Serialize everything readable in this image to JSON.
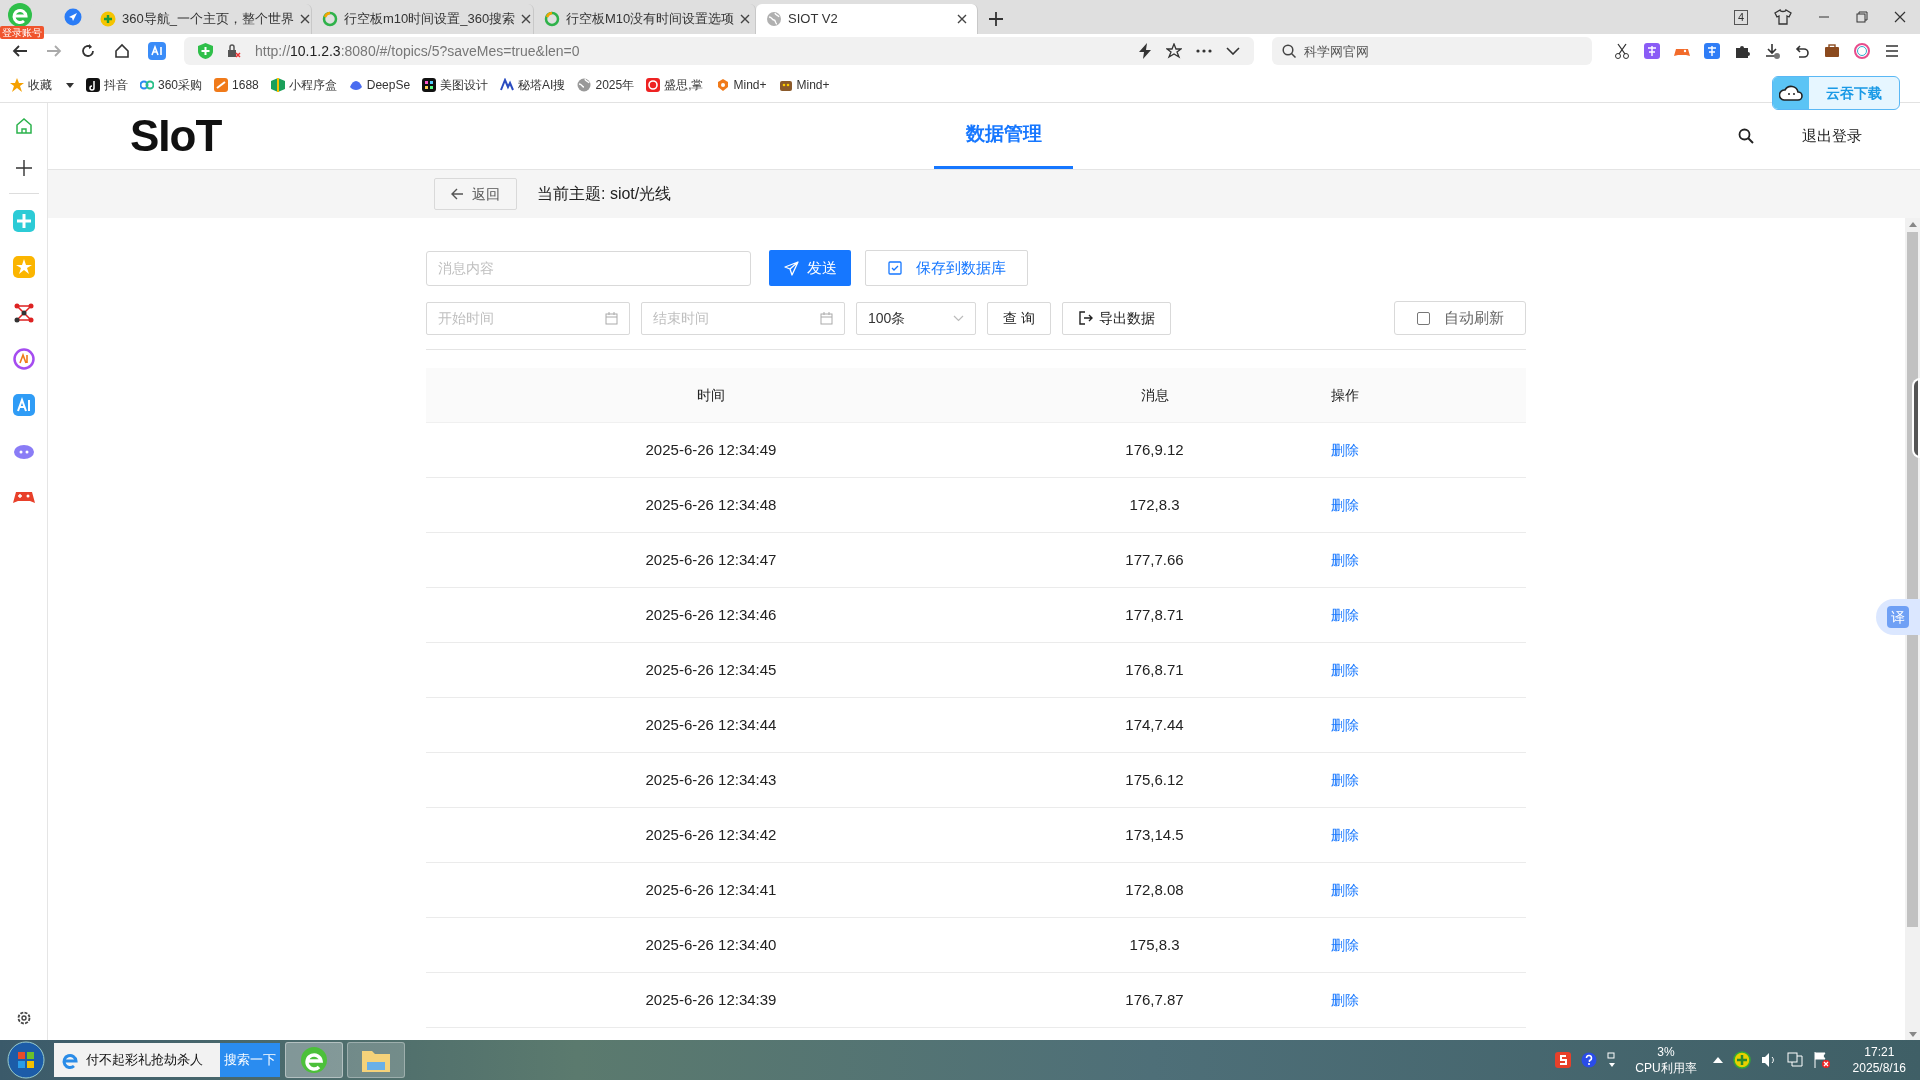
{
  "browser": {
    "login_badge": "登录账号",
    "tabs": [
      {
        "title": "360导航_一个主页，整个世界",
        "selected": false
      },
      {
        "title": "行空板m10时间设置_360搜索",
        "selected": false
      },
      {
        "title": "行空板M10没有时间设置选项",
        "selected": false
      },
      {
        "title": "SIOT V2",
        "selected": true
      }
    ],
    "tab_count": "4",
    "address_host": "10.1.2.3",
    "address_prefix": "http://",
    "address_rest": ":8080/#/topics/5?saveMes=true&len=0",
    "search_placeholder": "科学网官网",
    "bookmarks": [
      "收藏",
      "抖音",
      "360采购",
      "1688",
      "小程序盒",
      "DeepSe",
      "美图设计",
      "秘塔AI搜",
      "2025年",
      "盛思,掌",
      "Mind+",
      "Mind+"
    ],
    "download_button": "云吞下载"
  },
  "app": {
    "logo": "SIoT",
    "nav": [
      {
        "label": "数据管理",
        "selected": true
      }
    ],
    "logout": "退出登录",
    "back": "返回",
    "topic": "当前主题: siot/光线",
    "message_placeholder": "消息内容",
    "send": "发送",
    "save": "保存到数据库",
    "start_placeholder": "开始时间",
    "end_placeholder": "结束时间",
    "limit": "100条",
    "query": "查 询",
    "export": "导出数据",
    "auto_refresh": {
      "label": "自动刷新",
      "checked": false
    },
    "columns": [
      "时间",
      "消息",
      "操作"
    ],
    "rows": [
      {
        "time": "2025-6-26 12:34:49",
        "message": "176,9.12",
        "action": "删除"
      },
      {
        "time": "2025-6-26 12:34:48",
        "message": "172,8.3",
        "action": "删除"
      },
      {
        "time": "2025-6-26 12:34:47",
        "message": "177,7.66",
        "action": "删除"
      },
      {
        "time": "2025-6-26 12:34:46",
        "message": "177,8.71",
        "action": "删除"
      },
      {
        "time": "2025-6-26 12:34:45",
        "message": "176,8.71",
        "action": "删除"
      },
      {
        "time": "2025-6-26 12:34:44",
        "message": "174,7.44",
        "action": "删除"
      },
      {
        "time": "2025-6-26 12:34:43",
        "message": "175,6.12",
        "action": "删除"
      },
      {
        "time": "2025-6-26 12:34:42",
        "message": "173,14.5",
        "action": "删除"
      },
      {
        "time": "2025-6-26 12:34:41",
        "message": "172,8.08",
        "action": "删除"
      },
      {
        "time": "2025-6-26 12:34:40",
        "message": "175,8.3",
        "action": "删除"
      },
      {
        "time": "2025-6-26 12:34:39",
        "message": "176,7.87",
        "action": "删除"
      }
    ],
    "translate_button": "译"
  },
  "taskbar": {
    "search_text": "付不起彩礼抢劫杀人",
    "search_button": "搜索一下",
    "cpu_value": "3%",
    "cpu_label": "CPU利用率",
    "time": "17:21",
    "date": "2025/8/16"
  }
}
